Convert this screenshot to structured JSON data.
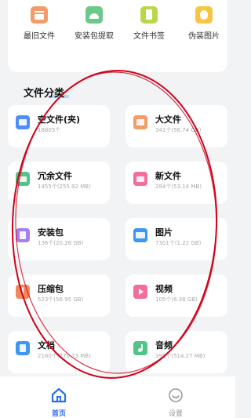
{
  "toolbar": {
    "items": [
      {
        "label": "最旧文件",
        "icon": "archive-box-icon",
        "color": "#f59b6a"
      },
      {
        "label": "安装包提取",
        "icon": "android-icon",
        "color": "#6cc788"
      },
      {
        "label": "文件书签",
        "icon": "bookmark-icon",
        "color": "#b8d84a"
      },
      {
        "label": "伪装图片",
        "icon": "disguise-image-icon",
        "color": "#f7c542"
      }
    ]
  },
  "section": {
    "title": "文件分类"
  },
  "categories": [
    {
      "name": "空文件(夹)",
      "detail": "18805个",
      "icon": "empty-folder-icon",
      "color": "#4f8ef7"
    },
    {
      "name": "大文件",
      "detail": "341个(56.74 GB)",
      "icon": "large-file-icon",
      "color": "#f59b6a"
    },
    {
      "name": "冗余文件",
      "detail": "1455个(255.92 MB)",
      "icon": "redundant-file-icon",
      "color": "#52c48a"
    },
    {
      "name": "新文件",
      "detail": "284个(53.14 MB)",
      "icon": "new-file-icon",
      "color": "#f26e9b"
    },
    {
      "name": "安装包",
      "detail": "136个(20.28 GB)",
      "icon": "package-icon",
      "color": "#a77df0"
    },
    {
      "name": "图片",
      "detail": "7301个(1.22 GB)",
      "icon": "image-icon",
      "color": "#3f95f2"
    },
    {
      "name": "压缩包",
      "detail": "523个(56.95 GB)",
      "icon": "zip-icon",
      "color": "#f08a5d"
    },
    {
      "name": "视频",
      "detail": "105个(6.38 GB)",
      "icon": "video-icon",
      "color": "#f26e9b"
    },
    {
      "name": "文档",
      "detail": "2160个(770.73 MB)",
      "icon": "document-icon",
      "color": "#3f95f2"
    },
    {
      "name": "音频",
      "detail": "395个(514.27 MB)",
      "icon": "audio-icon",
      "color": "#52c48a"
    }
  ],
  "nav": {
    "home_label": "首页",
    "settings_label": "设置",
    "active_color": "#2e6fe8",
    "inactive_color": "#9a9a9a"
  },
  "annotation_color": "#d0021b"
}
